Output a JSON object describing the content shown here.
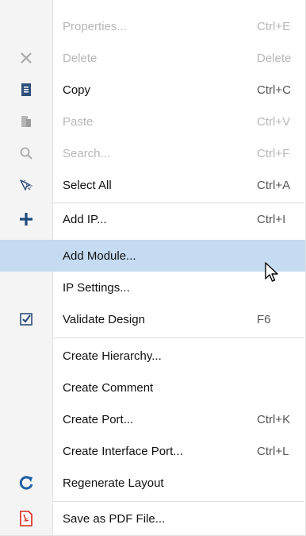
{
  "menu": {
    "items": [
      {
        "label": "Properties...",
        "shortcut": "Ctrl+E",
        "icon": "none",
        "enabled": false
      },
      {
        "label": "Delete",
        "shortcut": "Delete",
        "icon": "close-icon",
        "enabled": false
      },
      {
        "label": "Copy",
        "shortcut": "Ctrl+C",
        "icon": "copy-icon",
        "enabled": true
      },
      {
        "label": "Paste",
        "shortcut": "Ctrl+V",
        "icon": "paste-icon",
        "enabled": false
      },
      {
        "label": "Search...",
        "shortcut": "Ctrl+F",
        "icon": "search-icon",
        "enabled": false
      },
      {
        "label": "Select All",
        "shortcut": "Ctrl+A",
        "icon": "select-all-icon",
        "enabled": true
      },
      {
        "label": "Add IP...",
        "shortcut": "Ctrl+I",
        "icon": "add-icon",
        "enabled": true
      },
      {
        "label": "Add Module...",
        "shortcut": "",
        "icon": "none",
        "enabled": true,
        "highlighted": true
      },
      {
        "label": "IP Settings...",
        "shortcut": "",
        "icon": "none",
        "enabled": true
      },
      {
        "label": "Validate Design",
        "shortcut": "F6",
        "icon": "validate-icon",
        "enabled": true
      },
      {
        "label": "Create Hierarchy...",
        "shortcut": "",
        "icon": "none",
        "enabled": true
      },
      {
        "label": "Create Comment",
        "shortcut": "",
        "icon": "none",
        "enabled": true
      },
      {
        "label": "Create Port...",
        "shortcut": "Ctrl+K",
        "icon": "none",
        "enabled": true
      },
      {
        "label": "Create Interface Port...",
        "shortcut": "Ctrl+L",
        "icon": "none",
        "enabled": true
      },
      {
        "label": "Regenerate Layout",
        "shortcut": "",
        "icon": "refresh-icon",
        "enabled": true
      },
      {
        "label": "Save as PDF File...",
        "shortcut": "",
        "icon": "pdf-icon",
        "enabled": true
      }
    ]
  },
  "colors": {
    "highlight": "#c5dbf2",
    "accent_blue": "#1f5fa8",
    "disabled_text": "#b7b7b7",
    "gutter": "#f4f4f4",
    "pdf_red": "#d7261b"
  }
}
